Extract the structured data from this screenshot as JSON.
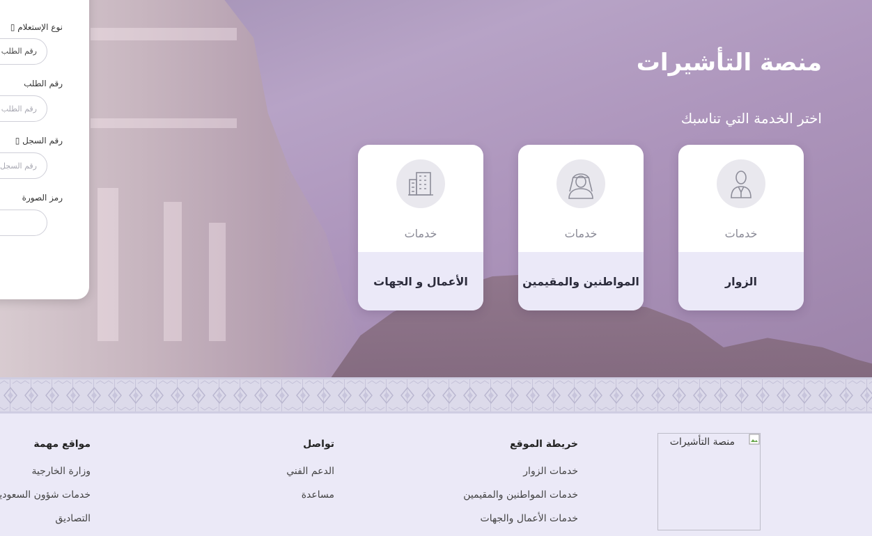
{
  "hero": {
    "title": "منصة التأشيرات",
    "subtitle": "اختر الخدمة التي تناسبك"
  },
  "cards": [
    {
      "icon": "visitor-icon",
      "label": "خدمات",
      "title": "الزوار"
    },
    {
      "icon": "citizen-icon",
      "label": "خدمات",
      "title": "المواطنين والمقيمين"
    },
    {
      "icon": "building-icon",
      "label": "خدمات",
      "title": "الأعمال و الجهات"
    }
  ],
  "form": {
    "usage_type_label": "نوع الإستعلام",
    "request_number_select": "رقم الطلب",
    "request_number_label": "رقم الطلب",
    "request_number_placeholder": "رقم الطلب",
    "record_number_label": "رقم السجل",
    "record_number_placeholder": "رقم السجل",
    "captcha_label": "رمز الصورة"
  },
  "footer": {
    "logo_alt": "منصة التأشيرات",
    "sitemap": {
      "title": "خريطة الموقع",
      "links": [
        "خدمات الزوار",
        "خدمات المواطنين والمقيمين",
        "خدمات الأعمال والجهات"
      ]
    },
    "contact": {
      "title": "تواصل",
      "links": [
        "الدعم الفني",
        "مساعدة"
      ]
    },
    "important": {
      "title": "مواقع مهمة",
      "links": [
        "وزارة الخارجية",
        "خدمات شؤون السعوديين",
        "التصاديق"
      ]
    }
  },
  "colors": {
    "hero_tint": "#ad95bc",
    "card_bottom": "#ebe9f8",
    "footer_bg": "#ebe9f7",
    "submit_button": "#373a63"
  }
}
